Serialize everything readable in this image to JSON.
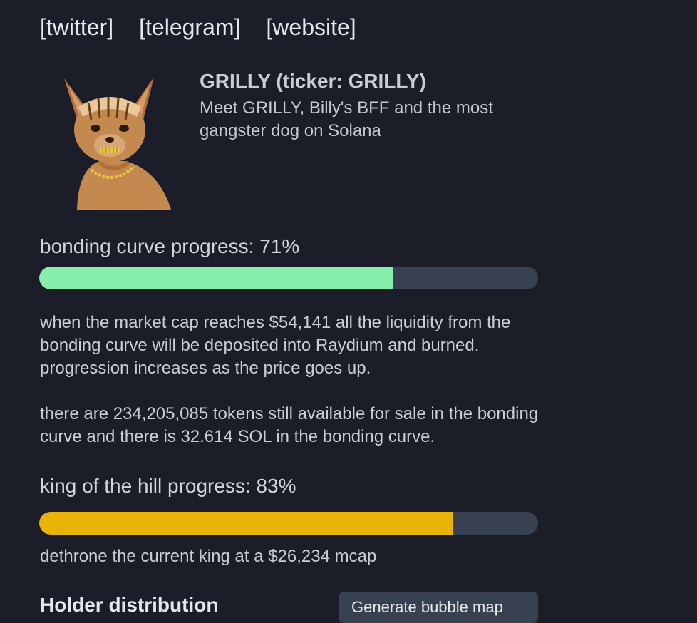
{
  "social_links": {
    "twitter": "[twitter]",
    "telegram": "[telegram]",
    "website": "[website]"
  },
  "token": {
    "title": "GRILLY (ticker: GRILLY)",
    "description": "Meet GRILLY, Billy's BFF and the most gangster dog on Solana"
  },
  "bonding_curve": {
    "label": "bonding curve progress: 71%",
    "progress_percent": 71,
    "bar_color": "#86efac",
    "info_1": "when the market cap reaches $54,141 all the liquidity from the bonding curve will be deposited into Raydium and burned. progression increases as the price goes up.",
    "info_2": "there are 234,205,085 tokens still available for sale in the bonding curve and there is 32.614 SOL in the bonding curve."
  },
  "king_of_hill": {
    "label": "king of the hill progress: 83%",
    "progress_percent": 83,
    "bar_color": "#eab308",
    "info": "dethrone the current king at a $26,234 mcap"
  },
  "holders": {
    "heading": "Holder distribution",
    "generate_button": "Generate bubble map"
  },
  "colors": {
    "background": "#1b1d28",
    "bar_track": "#374151"
  }
}
